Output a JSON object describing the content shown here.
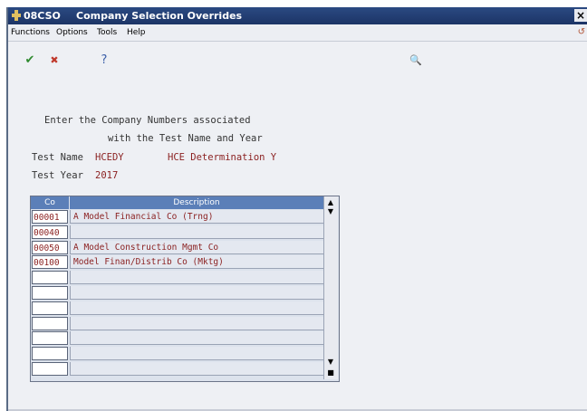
{
  "window": {
    "program_id": "08CSO",
    "title": "Company Selection Overrides",
    "close_glyph": "×"
  },
  "menu": [
    "Functions",
    "Options",
    "Tools",
    "Help"
  ],
  "toolbar": {
    "ok_glyph": "✔",
    "cancel_glyph": "✖",
    "help_glyph": "?",
    "search_glyph": "🔍"
  },
  "instructions": {
    "line1": "Enter the Company Numbers associated",
    "line2": "with the Test Name and Year"
  },
  "fields": {
    "test_name_label": "Test Name",
    "test_name_value": "HCEDY",
    "test_name_desc": "HCE Determination Y",
    "test_year_label": "Test Year",
    "test_year_value": "2017"
  },
  "grid": {
    "headers": [
      "Co",
      "Description"
    ],
    "rows": [
      {
        "co": "00001",
        "description": "A Model Financial Co (Trng)"
      },
      {
        "co": "00040",
        "description": ""
      },
      {
        "co": "00050",
        "description": "A Model Construction Mgmt Co"
      },
      {
        "co": "00100",
        "description": "Model Finan/Distrib Co (Mktg)"
      },
      {
        "co": "",
        "description": ""
      },
      {
        "co": "",
        "description": ""
      },
      {
        "co": "",
        "description": ""
      },
      {
        "co": "",
        "description": ""
      },
      {
        "co": "",
        "description": ""
      },
      {
        "co": "",
        "description": ""
      },
      {
        "co": "",
        "description": ""
      }
    ]
  },
  "colors": {
    "titlebar": "#1c3466",
    "header": "#5b7fb8",
    "field_text": "#8a1f1f"
  }
}
